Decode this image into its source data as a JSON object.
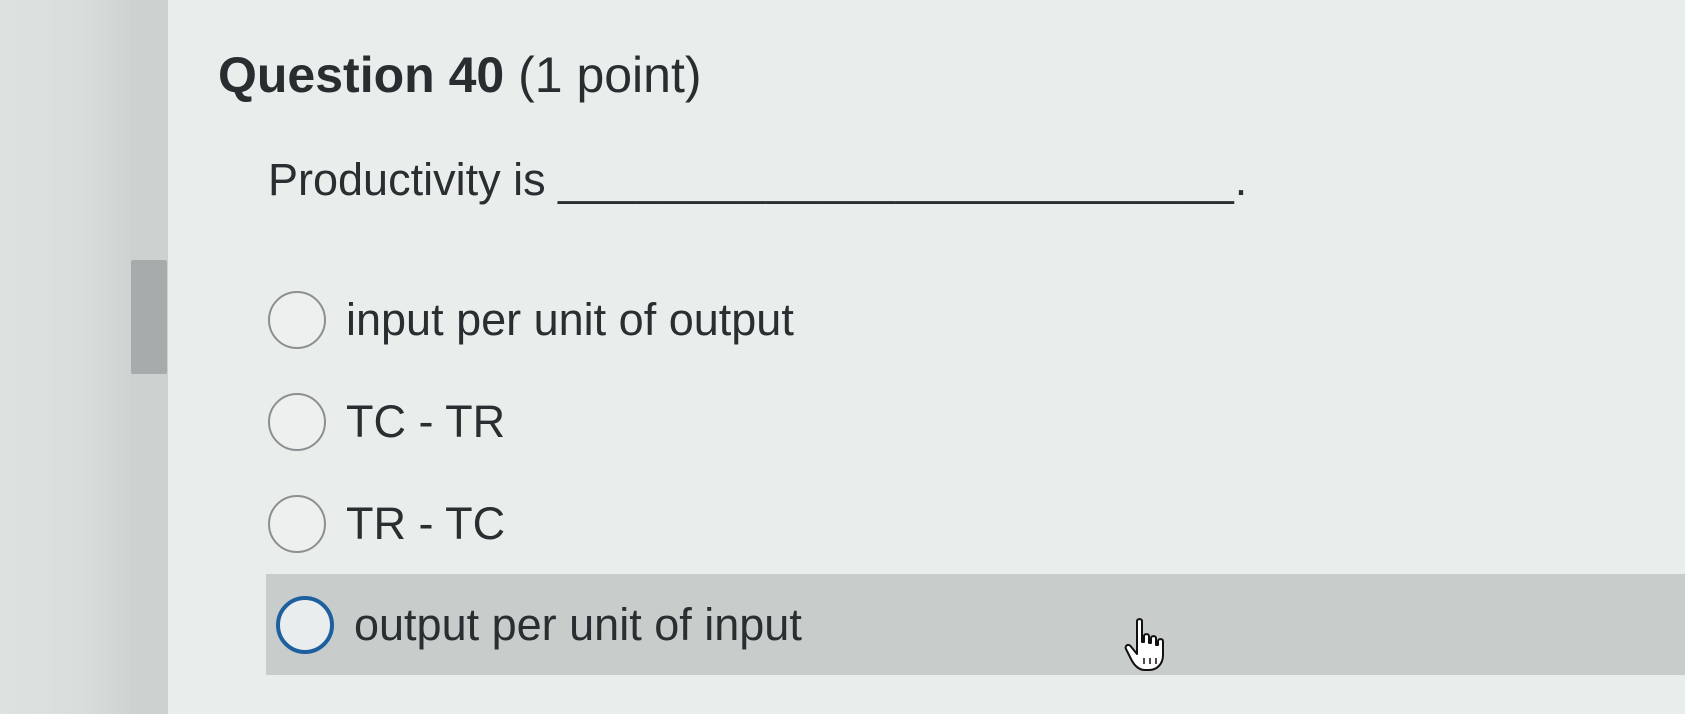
{
  "question": {
    "title": "Question 40",
    "points": "(1 point)",
    "prompt_prefix": "Productivity is",
    "prompt_blank": "__________________________."
  },
  "options": [
    {
      "label": "input per unit of output",
      "selected": false
    },
    {
      "label": "TC - TR",
      "selected": false
    },
    {
      "label": "TR - TC",
      "selected": false
    },
    {
      "label": "output per unit of input",
      "selected": false,
      "hovered": true
    }
  ],
  "colors": {
    "background": "#e9edec",
    "highlight": "#c8cccb",
    "focus_ring": "#1d5f9f",
    "text": "#2b2e31"
  },
  "icons": {
    "cursor": "hand-pointer-icon"
  }
}
